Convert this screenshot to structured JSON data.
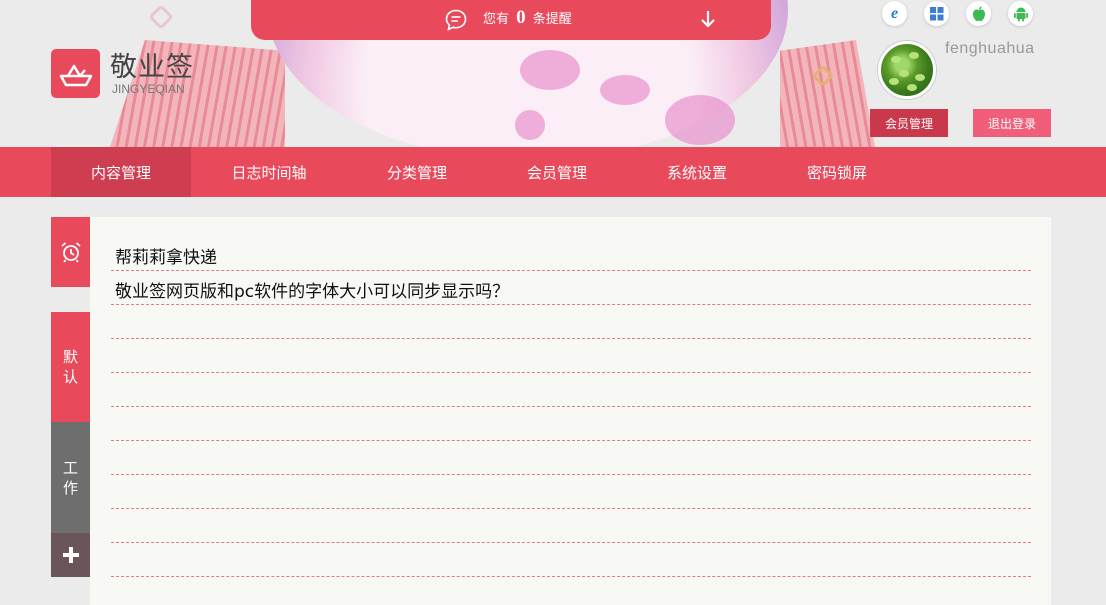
{
  "app": {
    "name": "敬业签",
    "name_pinyin": "JINGYEQIAN"
  },
  "reminder": {
    "prefix": "您有",
    "count": "0",
    "suffix": "条提醒"
  },
  "platforms": [
    "ie-icon",
    "windows-icon",
    "apple-icon",
    "android-icon"
  ],
  "user": {
    "username": "fenghuahua",
    "member_button": "会员管理",
    "logout_button": "退出登录"
  },
  "nav": {
    "items": [
      {
        "label": "内容管理",
        "active": true
      },
      {
        "label": "日志时间轴",
        "active": false
      },
      {
        "label": "分类管理",
        "active": false
      },
      {
        "label": "会员管理",
        "active": false
      },
      {
        "label": "系统设置",
        "active": false
      },
      {
        "label": "密码锁屏",
        "active": false
      }
    ]
  },
  "sidebar": {
    "tabs": [
      {
        "label": "默认",
        "active": true
      },
      {
        "label": "工作",
        "active": false
      }
    ]
  },
  "notes": [
    "帮莉莉拿快递",
    "敬业签网页版和pc软件的字体大小可以同步显示吗？"
  ],
  "colors": {
    "primary": "#e84a5c",
    "nav_active": "#cf3d51",
    "member_button": "#c9384b",
    "logout_button": "#f05e7a",
    "tab_inactive": "#6e6e6e",
    "add_tab": "#6a5559",
    "panel_bg": "#f8f8f5",
    "rule_line": "#e07a86"
  }
}
